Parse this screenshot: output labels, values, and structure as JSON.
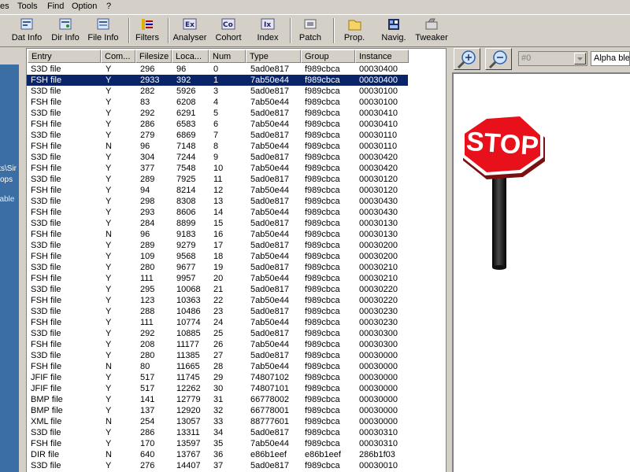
{
  "menu": [
    "es",
    "Tools",
    "Find",
    "Option",
    "?"
  ],
  "toolbar": [
    {
      "label": "Dat Info",
      "icon": "dat-info-icon"
    },
    {
      "label": "Dir Info",
      "icon": "dir-info-icon"
    },
    {
      "label": "File Info",
      "icon": "file-info-icon"
    },
    {
      "label": "Filters",
      "icon": "filters-icon"
    },
    {
      "label": "Analyser",
      "icon": "analyser-icon",
      "glyph": "Ex"
    },
    {
      "label": "Cohort",
      "icon": "cohort-icon",
      "glyph": "Co"
    },
    {
      "label": "Index",
      "icon": "index-icon",
      "glyph": "Ix"
    },
    {
      "label": "Patch",
      "icon": "patch-icon"
    },
    {
      "label": "Prop.",
      "icon": "properties-icon"
    },
    {
      "label": "Navig.",
      "icon": "navigator-icon"
    },
    {
      "label": "Tweaker",
      "icon": "tweaker-icon"
    }
  ],
  "left_fragments": [
    "its\\Sir",
    "ops",
    "nable"
  ],
  "columns": [
    "Entry",
    "Com...",
    "Filesize",
    "Loca...",
    "Num",
    "Type",
    "Group",
    "Instance"
  ],
  "rows": [
    [
      "S3D file",
      "Y",
      "296",
      "96",
      "0",
      "5ad0e817",
      "f989cbca",
      "00030400"
    ],
    [
      "FSH file",
      "Y",
      "2933",
      "392",
      "1",
      "7ab50e44",
      "f989cbca",
      "00030400"
    ],
    [
      "S3D file",
      "Y",
      "282",
      "5926",
      "3",
      "5ad0e817",
      "f989cbca",
      "00030100"
    ],
    [
      "FSH file",
      "Y",
      "83",
      "6208",
      "4",
      "7ab50e44",
      "f989cbca",
      "00030100"
    ],
    [
      "S3D file",
      "Y",
      "292",
      "6291",
      "5",
      "5ad0e817",
      "f989cbca",
      "00030410"
    ],
    [
      "FSH file",
      "Y",
      "286",
      "6583",
      "6",
      "7ab50e44",
      "f989cbca",
      "00030410"
    ],
    [
      "S3D file",
      "Y",
      "279",
      "6869",
      "7",
      "5ad0e817",
      "f989cbca",
      "00030110"
    ],
    [
      "FSH file",
      "N",
      "96",
      "7148",
      "8",
      "7ab50e44",
      "f989cbca",
      "00030110"
    ],
    [
      "S3D file",
      "Y",
      "304",
      "7244",
      "9",
      "5ad0e817",
      "f989cbca",
      "00030420"
    ],
    [
      "FSH file",
      "Y",
      "377",
      "7548",
      "10",
      "7ab50e44",
      "f989cbca",
      "00030420"
    ],
    [
      "S3D file",
      "Y",
      "289",
      "7925",
      "11",
      "5ad0e817",
      "f989cbca",
      "00030120"
    ],
    [
      "FSH file",
      "Y",
      "94",
      "8214",
      "12",
      "7ab50e44",
      "f989cbca",
      "00030120"
    ],
    [
      "S3D file",
      "Y",
      "298",
      "8308",
      "13",
      "5ad0e817",
      "f989cbca",
      "00030430"
    ],
    [
      "FSH file",
      "Y",
      "293",
      "8606",
      "14",
      "7ab50e44",
      "f989cbca",
      "00030430"
    ],
    [
      "S3D file",
      "Y",
      "284",
      "8899",
      "15",
      "5ad0e817",
      "f989cbca",
      "00030130"
    ],
    [
      "FSH file",
      "N",
      "96",
      "9183",
      "16",
      "7ab50e44",
      "f989cbca",
      "00030130"
    ],
    [
      "S3D file",
      "Y",
      "289",
      "9279",
      "17",
      "5ad0e817",
      "f989cbca",
      "00030200"
    ],
    [
      "FSH file",
      "Y",
      "109",
      "9568",
      "18",
      "7ab50e44",
      "f989cbca",
      "00030200"
    ],
    [
      "S3D file",
      "Y",
      "280",
      "9677",
      "19",
      "5ad0e817",
      "f989cbca",
      "00030210"
    ],
    [
      "FSH file",
      "Y",
      "111",
      "9957",
      "20",
      "7ab50e44",
      "f989cbca",
      "00030210"
    ],
    [
      "S3D file",
      "Y",
      "295",
      "10068",
      "21",
      "5ad0e817",
      "f989cbca",
      "00030220"
    ],
    [
      "FSH file",
      "Y",
      "123",
      "10363",
      "22",
      "7ab50e44",
      "f989cbca",
      "00030220"
    ],
    [
      "S3D file",
      "Y",
      "288",
      "10486",
      "23",
      "5ad0e817",
      "f989cbca",
      "00030230"
    ],
    [
      "FSH file",
      "Y",
      "111",
      "10774",
      "24",
      "7ab50e44",
      "f989cbca",
      "00030230"
    ],
    [
      "S3D file",
      "Y",
      "292",
      "10885",
      "25",
      "5ad0e817",
      "f989cbca",
      "00030300"
    ],
    [
      "FSH file",
      "Y",
      "208",
      "11177",
      "26",
      "7ab50e44",
      "f989cbca",
      "00030300"
    ],
    [
      "S3D file",
      "Y",
      "280",
      "11385",
      "27",
      "5ad0e817",
      "f989cbca",
      "00030000"
    ],
    [
      "FSH file",
      "N",
      "80",
      "11665",
      "28",
      "7ab50e44",
      "f989cbca",
      "00030000"
    ],
    [
      "JFIF file",
      "Y",
      "517",
      "11745",
      "29",
      "74807102",
      "f989cbca",
      "00030000"
    ],
    [
      "JFIF file",
      "Y",
      "517",
      "12262",
      "30",
      "74807101",
      "f989cbca",
      "00030000"
    ],
    [
      "BMP file",
      "Y",
      "141",
      "12779",
      "31",
      "66778002",
      "f989cbca",
      "00030000"
    ],
    [
      "BMP file",
      "Y",
      "137",
      "12920",
      "32",
      "66778001",
      "f989cbca",
      "00030000"
    ],
    [
      "XML file",
      "N",
      "254",
      "13057",
      "33",
      "88777601",
      "f989cbca",
      "00030000"
    ],
    [
      "S3D file",
      "Y",
      "286",
      "13311",
      "34",
      "5ad0e817",
      "f989cbca",
      "00030310"
    ],
    [
      "FSH file",
      "Y",
      "170",
      "13597",
      "35",
      "7ab50e44",
      "f989cbca",
      "00030310"
    ],
    [
      "DIR file",
      "N",
      "640",
      "13767",
      "36",
      "e86b1eef",
      "e86b1eef",
      "286b1f03"
    ],
    [
      "S3D file",
      "Y",
      "276",
      "14407",
      "37",
      "5ad0e817",
      "f989cbca",
      "00030010"
    ]
  ],
  "selected_row": 1,
  "preview": {
    "combo_value": "#0",
    "alpha_field": "Alpha blen",
    "sign_text": "STOP"
  },
  "colors": {
    "desktop_blue": "#3a6ea5",
    "selection": "#0a246a",
    "sign_red": "#e8101a"
  }
}
